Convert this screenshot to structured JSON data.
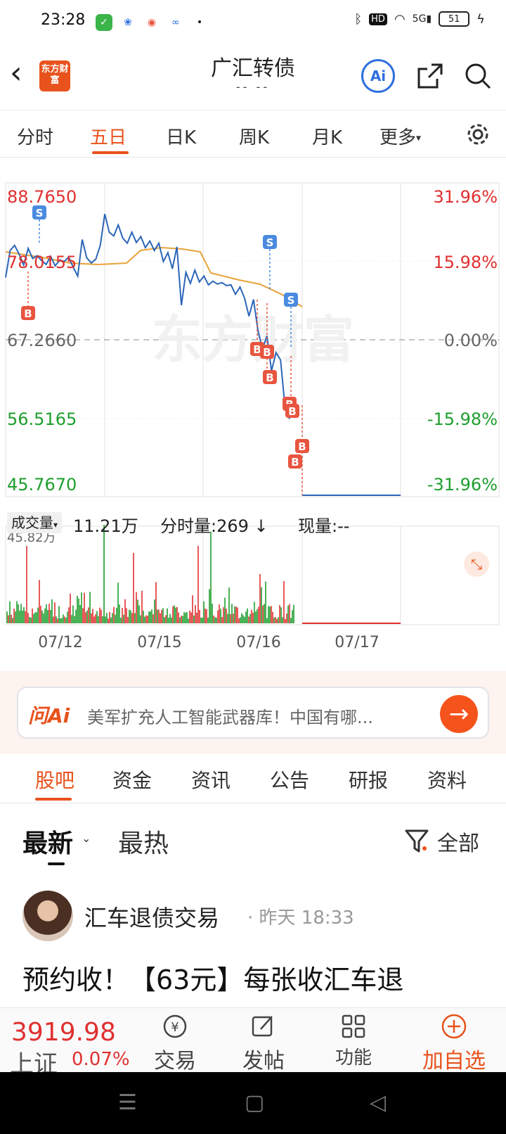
{
  "status": {
    "time": "23:28",
    "battery": "51",
    "indicators": [
      "bluetooth",
      "HD",
      "wifi",
      "5G signal",
      "charging"
    ]
  },
  "header": {
    "back_icon": "back-icon",
    "logo_text": "东方财富",
    "title": "广汇转债",
    "subtitle": "-- --",
    "ai_label": "Ai"
  },
  "period_tabs": [
    "分时",
    "五日",
    "日K",
    "周K",
    "月K",
    "更多"
  ],
  "period_tabs_active": "五日",
  "chart": {
    "price_labels": [
      "88.7650",
      "78.0155",
      "67.2660",
      "56.5165",
      "45.7670"
    ],
    "pct_labels": [
      "31.96%",
      "15.98%",
      "0.00%",
      "-15.98%",
      "-31.96%"
    ],
    "watermark": "东方财富",
    "vol_select": "成交量",
    "vol_value": "11.21万",
    "fs_vol": "分时量:269",
    "now_vol": "现量:--",
    "vol_max_label": "45.82万",
    "date_labels": [
      "07/12",
      "07/15",
      "07/16",
      "07/17"
    ],
    "colors": {
      "up": "#e03030",
      "down": "#1e9e2e",
      "price_line": "#2b66b8",
      "avg_line": "#e8a33a",
      "buy_marker": "#e8553f",
      "sell_marker": "#4a8be0"
    }
  },
  "chart_data": {
    "type": "line",
    "series": [
      {
        "name": "",
        "values": [
          75.8,
          79.5,
          80.2,
          79.0,
          77.5,
          79.8,
          78.4,
          78.8,
          78.1,
          77.6,
          78.7,
          77.4,
          78.2,
          78.0,
          78.6,
          77.2,
          76.0,
          81.0,
          78.5,
          77.8,
          78.3,
          80.2,
          84.5,
          82.0,
          81.5,
          83.0,
          81.2,
          80.5,
          82.0,
          80.6,
          81.4,
          79.9,
          80.8,
          79.5,
          80.5,
          78.0,
          79.2,
          77.0,
          80.0,
          72.0,
          76.5,
          75.0,
          76.8,
          75.2,
          76.0,
          74.8,
          75.3,
          74.9,
          75.1,
          74.7,
          74.8,
          73.5,
          74.5,
          73.0,
          70.5,
          72.8,
          68.5,
          66.0,
          67.8,
          63.0,
          65.5,
          64.5,
          58.0,
          56.4
        ]
      }
    ],
    "markers": [
      {
        "type": "S",
        "label": "S"
      },
      {
        "type": "B",
        "label": "B"
      },
      {
        "type": "S",
        "label": "S"
      },
      {
        "type": "S",
        "label": "S"
      },
      {
        "type": "B",
        "label": "B"
      },
      {
        "type": "B",
        "label": "B"
      },
      {
        "type": "B",
        "label": "B"
      },
      {
        "type": "B",
        "label": "B"
      },
      {
        "type": "B",
        "label": "B"
      },
      {
        "type": "B",
        "label": "B"
      },
      {
        "type": "B",
        "label": "B"
      }
    ],
    "ylim": [
      45.767,
      88.765
    ],
    "x": [
      "07/12",
      "07/15",
      "07/16",
      "07/17"
    ]
  },
  "ai_banner": {
    "label": "问Ai",
    "text": "美军扩充人工智能武器库！中国有哪..."
  },
  "section_tabs": [
    "股吧",
    "资金",
    "资讯",
    "公告",
    "研报",
    "资料"
  ],
  "section_tabs_active": "股吧",
  "sort": {
    "latest": "最新",
    "hot": "最热",
    "filter": "全部"
  },
  "post": {
    "author": "汇车退债交易",
    "time": "· 昨天 18:33",
    "body": "预约收！【63元】每张收汇车退"
  },
  "bottom": {
    "index_value": "3919.98",
    "index_name": "上证",
    "index_change": "0.07%",
    "items": [
      "交易",
      "发帖",
      "功能",
      "加自选"
    ]
  }
}
